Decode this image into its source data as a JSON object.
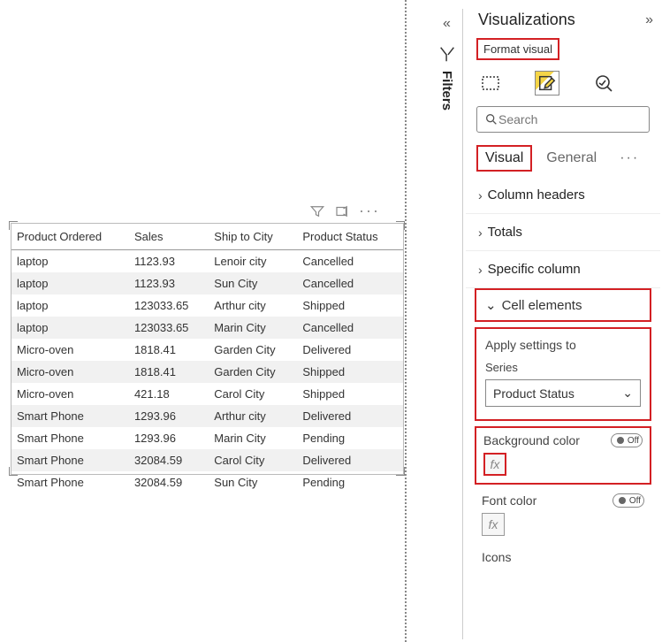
{
  "panel": {
    "title": "Visualizations",
    "format_visual_label": "Format visual",
    "search_placeholder": "Search",
    "tabs": {
      "visual": "Visual",
      "general": "General"
    },
    "sections": {
      "column_headers": "Column headers",
      "totals": "Totals",
      "specific_column": "Specific column",
      "cell_elements": "Cell elements"
    },
    "apply_settings": {
      "title": "Apply settings to",
      "series_label": "Series",
      "series_value": "Product Status"
    },
    "settings": {
      "background_color": {
        "label": "Background color",
        "state": "Off"
      },
      "font_color": {
        "label": "Font color",
        "state": "Off"
      },
      "icons": {
        "label": "Icons"
      }
    }
  },
  "filters": {
    "label": "Filters"
  },
  "table": {
    "headers": [
      "Product Ordered",
      "Sales",
      "Ship to City",
      "Product Status"
    ],
    "rows": [
      [
        "laptop",
        "1123.93",
        "Lenoir city",
        "Cancelled"
      ],
      [
        "laptop",
        "1123.93",
        "Sun City",
        "Cancelled"
      ],
      [
        "laptop",
        "123033.65",
        "Arthur city",
        "Shipped"
      ],
      [
        "laptop",
        "123033.65",
        "Marin City",
        "Cancelled"
      ],
      [
        "Micro-oven",
        "1818.41",
        "Garden City",
        "Delivered"
      ],
      [
        "Micro-oven",
        "1818.41",
        "Garden City",
        "Shipped"
      ],
      [
        "Micro-oven",
        "421.18",
        "Carol City",
        "Shipped"
      ],
      [
        "Smart Phone",
        "1293.96",
        "Arthur city",
        "Delivered"
      ],
      [
        "Smart Phone",
        "1293.96",
        "Marin City",
        "Pending"
      ],
      [
        "Smart Phone",
        "32084.59",
        "Carol City",
        "Delivered"
      ],
      [
        "Smart Phone",
        "32084.59",
        "Sun City",
        "Pending"
      ]
    ]
  }
}
